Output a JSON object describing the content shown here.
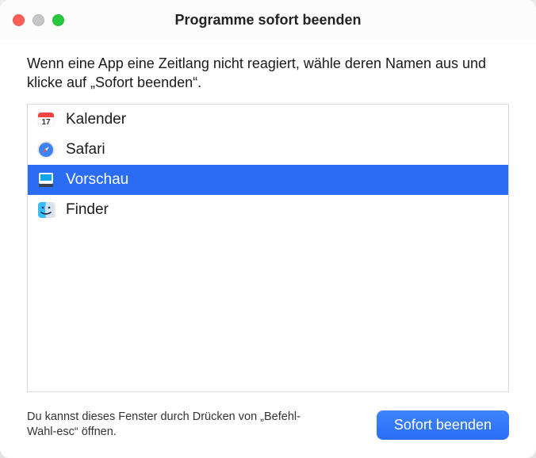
{
  "window": {
    "title": "Programme sofort beenden"
  },
  "instructions": "Wenn eine App eine Zeitlang nicht reagiert, wähle deren Namen aus und klicke auf „Sofort beenden“.",
  "apps": [
    {
      "name": "Kalender",
      "icon": "calendar-icon",
      "selected": false
    },
    {
      "name": "Safari",
      "icon": "safari-icon",
      "selected": false
    },
    {
      "name": "Vorschau",
      "icon": "preview-icon",
      "selected": true
    },
    {
      "name": "Finder",
      "icon": "finder-icon",
      "selected": false
    }
  ],
  "hint": "Du kannst dieses Fenster durch Drücken von „Befehl-Wahl-esc“ öffnen.",
  "button": {
    "force_quit": "Sofort beenden"
  }
}
